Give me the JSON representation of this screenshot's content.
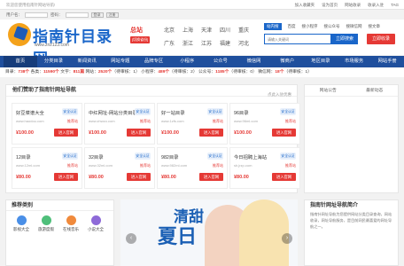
{
  "topbar": {
    "welcome": "欢迎您使用指南针网站导航!",
    "links": [
      "加入收藏夹",
      "设为首页",
      "网站收录",
      "收录入驻",
      "TAG"
    ]
  },
  "login": {
    "user_label": "用户名：",
    "pass_label": "密码：",
    "login_btn": "登录",
    "register_btn": "注册"
  },
  "logo": {
    "title": "指南针目录网",
    "url": "www.znz123.com"
  },
  "city": {
    "current": "总站",
    "switch": "[切换省份]",
    "list": [
      "北京",
      "上海",
      "天津",
      "四川",
      "重庆",
      "广东",
      "浙江",
      "江苏",
      "福建",
      "河北"
    ]
  },
  "search": {
    "tabs": [
      "站内搜",
      "百度",
      "搜小程序",
      "搜公众号",
      "搜微信网",
      "搜文章"
    ],
    "placeholder": "请输入关键词",
    "go": "立即搜索",
    "add": "立即收录"
  },
  "nav": [
    "首页",
    "分类目录",
    "新闻资讯",
    "网站专题",
    "品牌专区",
    "小程序",
    "公众号",
    "微信网",
    "微商户",
    "地区目录",
    "市场服务",
    "网站手册"
  ],
  "stats": {
    "sites_label": "目录：",
    "sites": "738个",
    "mini_label": "各类：",
    "mini": "11590个",
    "pub_label": "文字：",
    "pub": "811篇",
    "apps_label": "网站：",
    "apps": "2520个",
    "pending1": "（待审核：1）",
    "apps2_label": "公众号：",
    "apps2": "",
    "mp_label": "小程序：",
    "mp": "489个",
    "pending2": "（待审核：2）",
    "gzh_label": "公众号：",
    "gzh": "1185个",
    "pending3": "（待审核：0）",
    "wx_label": "微信网：",
    "wx": "18个",
    "pending4": "（待审核：1）"
  },
  "featured": {
    "title": "他们赞助了指南针网址导航",
    "more": "点此入驻优惠",
    "cards": [
      {
        "name": "好豆菜谱大全",
        "badge": "安全认证",
        "url": "www.haodou.com",
        "rec": "推荐站",
        "price": "¥100.00",
        "btn": "进入官网"
      },
      {
        "name": "中红网址-网站分类目录...",
        "badge": "安全认证",
        "url": "www.zhwzo.com",
        "rec": "推荐站",
        "price": "¥100.00",
        "btn": "进入官网"
      },
      {
        "name": "好一站目录",
        "badge": "安全认证",
        "url": "www.1zfs.com",
        "rec": "推荐站",
        "price": "¥100.00",
        "btn": "进入官网"
      },
      {
        "name": "96目录",
        "badge": "安全认证",
        "url": "www.96ml.com",
        "rec": "推荐站",
        "price": "¥100.00",
        "btn": "进入官网"
      },
      {
        "name": "12目录",
        "badge": "安全认证",
        "url": "www.12ml.com",
        "rec": "推荐站",
        "price": "¥80.00",
        "btn": "进入官网"
      },
      {
        "name": "32目录",
        "badge": "安全认证",
        "url": "www.32ml.com",
        "rec": "推荐站",
        "price": "¥80.00",
        "btn": "进入官网"
      },
      {
        "name": "982目录",
        "badge": "安全认证",
        "url": "www.982ml.com",
        "rec": "推荐站",
        "price": "¥80.00",
        "btn": "进入官网"
      },
      {
        "name": "今日招聘上海站",
        "badge": "安全认证",
        "url": "sh.jrzp.com",
        "rec": "推荐站",
        "price": "¥80.00",
        "btn": "进入官网"
      }
    ]
  },
  "side": {
    "tabs": [
      "网站公告",
      "最新动态"
    ]
  },
  "categories": {
    "title": "推荐类别",
    "items": [
      {
        "label": "影视大全",
        "color": "#4a8fe7"
      },
      {
        "label": "旅游度假",
        "color": "#4fbf7a"
      },
      {
        "label": "在线音乐",
        "color": "#f08a3c"
      },
      {
        "label": "小说大全",
        "color": "#8e6ad8"
      }
    ]
  },
  "banner": {
    "big": "夏日",
    "small": "清甜"
  },
  "intro": {
    "title": "指南针网址导航简介",
    "text": "指南针网址导航为您提供网站分类目录查询，网站收录，网址导航服务，是目前网民最喜爱的网址导航之一。"
  }
}
